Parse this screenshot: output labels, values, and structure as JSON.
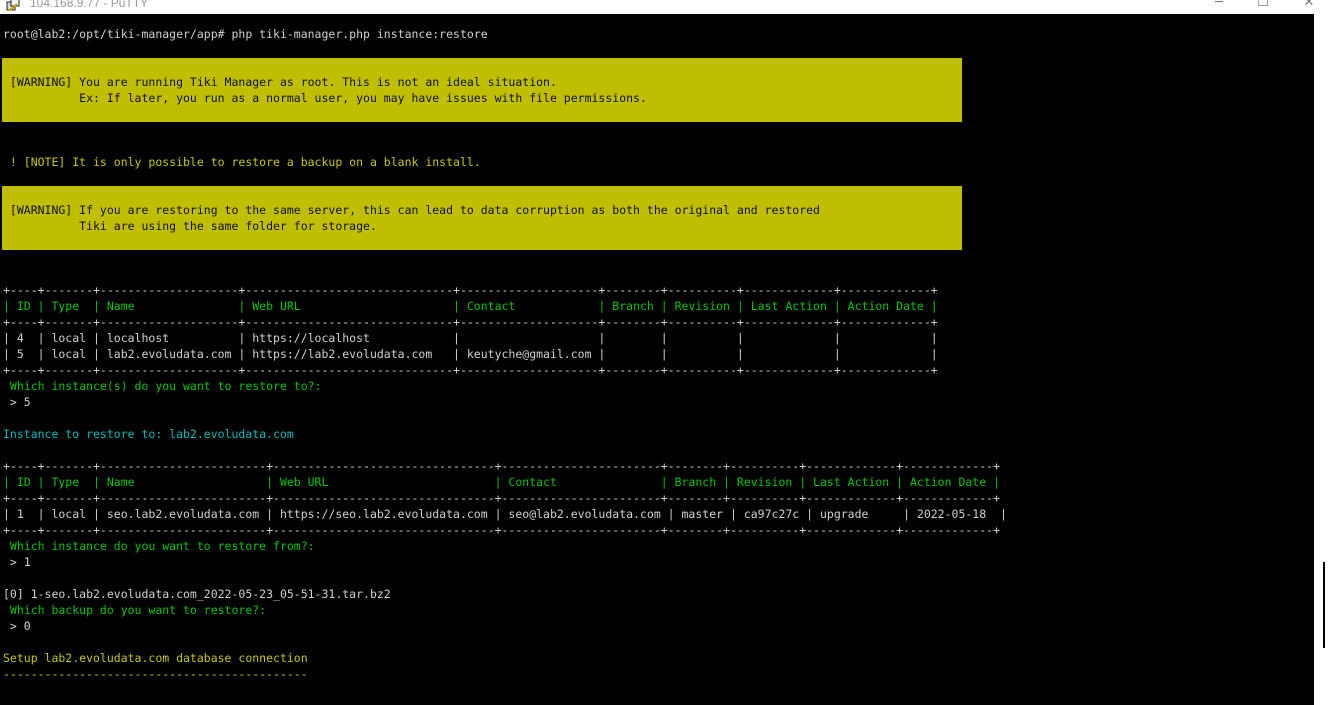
{
  "window": {
    "title": "104.168.9.77 - PuTTY",
    "app_icon": "putty-icon",
    "controls": {
      "minimize": "─",
      "maximize": "☐",
      "close": "✕"
    }
  },
  "terminal": {
    "colors": {
      "background": "#000000",
      "warning_bg": "#bfbf00",
      "green": "#00c800",
      "cyan": "#00bcbc",
      "white": "#d0d0d0"
    },
    "prompt": "root@lab2:/opt/tiki-manager/app# php tiki-manager.php instance:restore",
    "warning1": {
      "line1": " [WARNING] You are running Tiki Manager as root. This is not an ideal situation.",
      "line2": "           Ex: If later, you run as a normal user, you may have issues with file permissions."
    },
    "note": " ! [NOTE] It is only possible to restore a backup on a blank install.",
    "warning2": {
      "line1": " [WARNING] If you are restoring to the same server, this can lead to data corruption as both the original and restored",
      "line2": "           Tiki are using the same folder for storage."
    },
    "table1": {
      "sep": "+----+-------+--------------------+------------------------------+--------------------+--------+----------+-------------+-------------+",
      "header": "| ID | Type  | Name               | Web URL                      | Contact            | Branch | Revision | Last Action | Action Date |",
      "rows": [
        "| 4  | local | localhost          | https://localhost            |                    |        |          |             |             |",
        "| 5  | local | lab2.evoludata.com | https://lab2.evoludata.com   | keutyche@gmail.com |        |          |             |             |"
      ]
    },
    "q1": " Which instance(s) do you want to restore to?:",
    "a1": " > 5",
    "instance_line": "Instance to restore to: lab2.evoludata.com",
    "table2": {
      "sep": "+----+-------+------------------------+--------------------------------+-----------------------+--------+----------+-------------+-------------+",
      "header": "| ID | Type  | Name                   | Web URL                        | Contact               | Branch | Revision | Last Action | Action Date |",
      "rows": [
        "| 1  | local | seo.lab2.evoludata.com | https://seo.lab2.evoludata.com | seo@lab2.evoludata.com | master | ca97c27c | upgrade     | 2022-05-18  |"
      ]
    },
    "q2": " Which instance do you want to restore from?:",
    "a2": " > 1",
    "backup_item": "[0] 1-seo.lab2.evoludata.com_2022-05-23_05-51-31.tar.bz2",
    "q3": " Which backup do you want to restore?:",
    "a3": " > 0",
    "setup": "Setup lab2.evoludata.com database connection",
    "setup_rule": "--------------------------------------------"
  }
}
